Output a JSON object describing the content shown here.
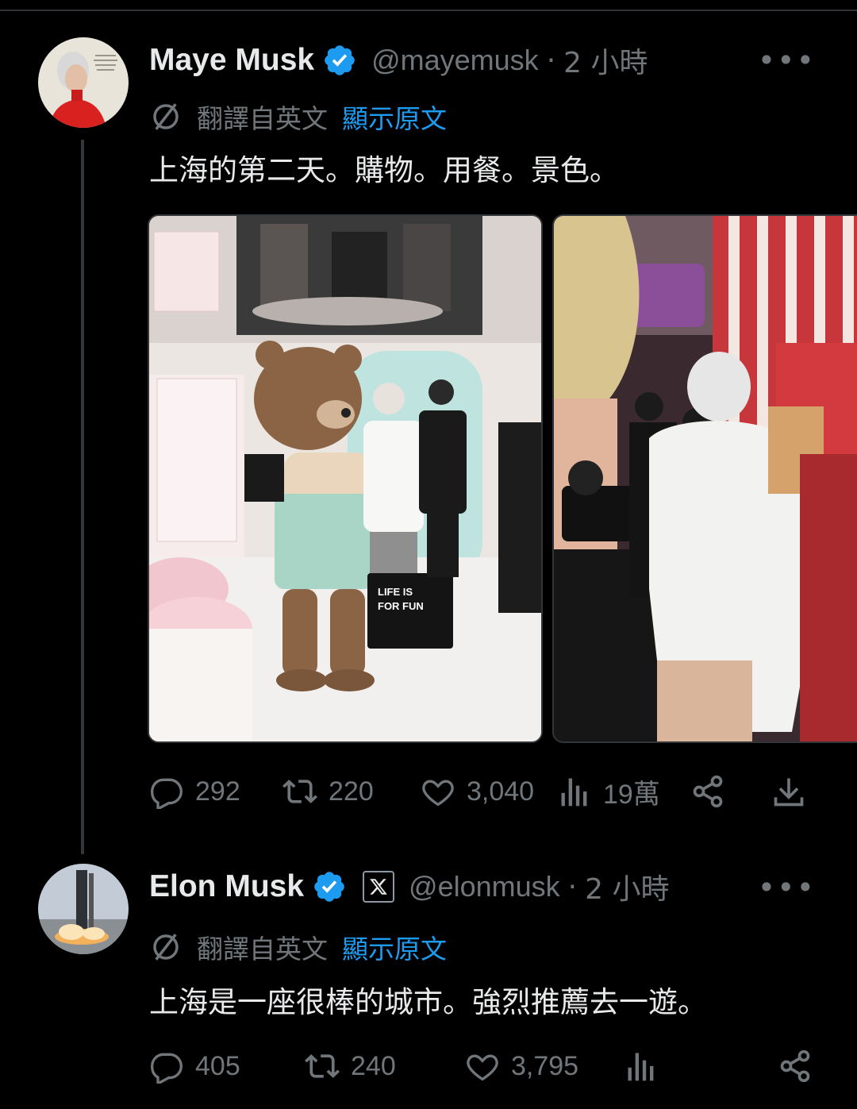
{
  "tweets": [
    {
      "name": "Maye Musk",
      "handle": "@mayemusk",
      "time": "2 小時",
      "translate_label": "翻譯自英文",
      "show_original": "顯示原文",
      "text": "上海的第二天。購物。用餐。景色。",
      "photo_text": [
        "LIFE IS",
        "FOR FUN"
      ],
      "stats": {
        "replies": "292",
        "retweets": "220",
        "likes": "3,040",
        "views": "19萬"
      }
    },
    {
      "name": "Elon Musk",
      "handle": "@elonmusk",
      "time": "2 小時",
      "translate_label": "翻譯自英文",
      "show_original": "顯示原文",
      "text": "上海是一座很棒的城市。強烈推薦去一遊。",
      "stats": {
        "replies": "405",
        "retweets": "240",
        "likes": "3,795"
      }
    }
  ],
  "colors": {
    "verified": "#1d9bf0",
    "link": "#1d9bf0",
    "muted": "#71767b"
  },
  "icons": [
    "verified-badge-icon",
    "x-logo-icon",
    "translate-icon",
    "reply-icon",
    "retweet-icon",
    "like-icon",
    "views-icon",
    "share-icon",
    "download-icon",
    "more-icon"
  ]
}
